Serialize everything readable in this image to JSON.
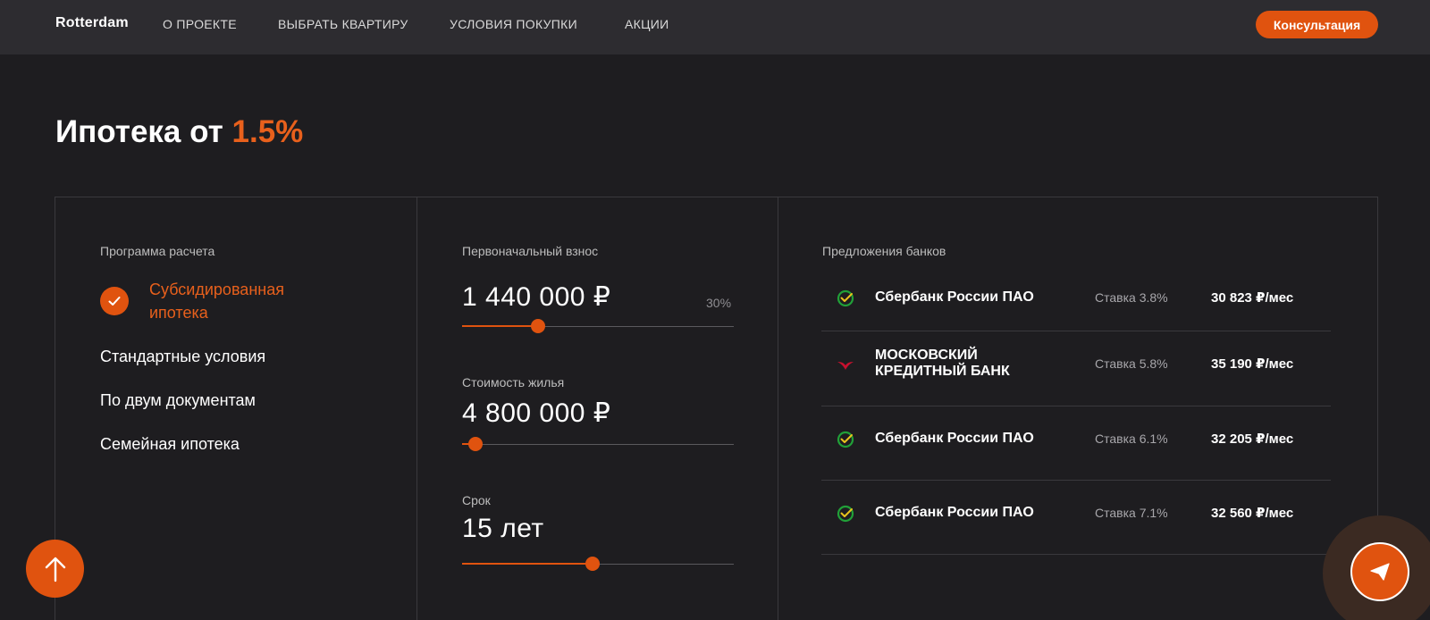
{
  "header": {
    "logo": "Rotterdam",
    "nav": [
      "О ПРОЕКТЕ",
      "ВЫБРАТЬ КВАРТИРУ",
      "УСЛОВИЯ ПОКУПКИ",
      "АКЦИИ"
    ],
    "cta": "Консультация"
  },
  "title": {
    "main": "Ипотека от",
    "accent": "1.5%"
  },
  "program": {
    "label": "Программа расчета",
    "active": "Субсидированная ипотека",
    "options": [
      "Стандартные условия",
      "По двум документам",
      "Семейная ипотека"
    ]
  },
  "sliders": {
    "down_payment": {
      "label": "Первоначальный взнос",
      "value": "1 440 000 ₽",
      "percent": "30%",
      "fill_fraction": 0.28
    },
    "price": {
      "label": "Стоимость жилья",
      "value": "4 800 000 ₽",
      "fill_fraction": 0.05
    },
    "term": {
      "label": "Срок",
      "value": "15 лет",
      "fill_fraction": 0.48
    }
  },
  "banks": {
    "label": "Предложения банков",
    "rows": [
      {
        "name": "Сбербанк России ПАО",
        "rate": "Ставка 3.8%",
        "payment": "30 823 ₽/мес",
        "logo": "sber-icon"
      },
      {
        "name": "МОСКОВСКИЙ КРЕДИТНЫЙ БАНК",
        "rate": "Ставка 5.8%",
        "payment": "35 190 ₽/мес",
        "logo": "mkb-icon"
      },
      {
        "name": "Сбербанк России ПАО",
        "rate": "Ставка 6.1%",
        "payment": "32 205 ₽/мес",
        "logo": "sber-icon"
      },
      {
        "name": "Сбербанк России ПАО",
        "rate": "Ставка 7.1%",
        "payment": "32 560 ₽/мес",
        "logo": "sber-icon"
      }
    ]
  },
  "colors": {
    "accent": "#e0530f",
    "background": "#1e1d20",
    "header": "#2d2c30"
  },
  "icons": {
    "scroll_up": "arrow-up-icon",
    "send": "paper-plane-icon",
    "check": "check-icon"
  }
}
